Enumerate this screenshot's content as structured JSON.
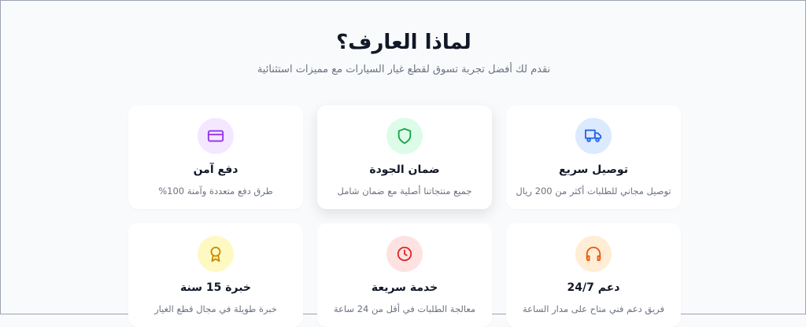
{
  "header": {
    "title": "لماذا العارف؟",
    "subtitle": "نقدم لك أفضل تجربة تسوق لقطع غيار السيارات مع مميزات استثنائية"
  },
  "features": [
    {
      "title": "توصيل سريع",
      "description": "توصيل مجاني للطلبات أكثر من 200 ريال",
      "icon": "truck-icon",
      "icon_color": "#2563eb",
      "icon_bg": "#dbeafe"
    },
    {
      "title": "ضمان الجودة",
      "description": "جميع منتجاتنا أصلية مع ضمان شامل",
      "icon": "shield-icon",
      "icon_color": "#16a34a",
      "icon_bg": "#dcfce7"
    },
    {
      "title": "دفع آمن",
      "description": "طرق دفع متعددة وآمنة 100%",
      "icon": "credit-card-icon",
      "icon_color": "#9333ea",
      "icon_bg": "#f3e8ff"
    },
    {
      "title": "دعم 24/7",
      "description": "فريق دعم فني متاح على مدار الساعة",
      "icon": "headphones-icon",
      "icon_color": "#ea580c",
      "icon_bg": "#ffedd5"
    },
    {
      "title": "خدمة سريعة",
      "description": "معالجة الطلبات في أقل من 24 ساعة",
      "icon": "clock-icon",
      "icon_color": "#dc2626",
      "icon_bg": "#fee2e2"
    },
    {
      "title": "خبرة 15 سنة",
      "description": "خبرة طويلة في مجال قطع الغيار",
      "icon": "award-icon",
      "icon_color": "#ca8a04",
      "icon_bg": "#fef9c3"
    }
  ]
}
